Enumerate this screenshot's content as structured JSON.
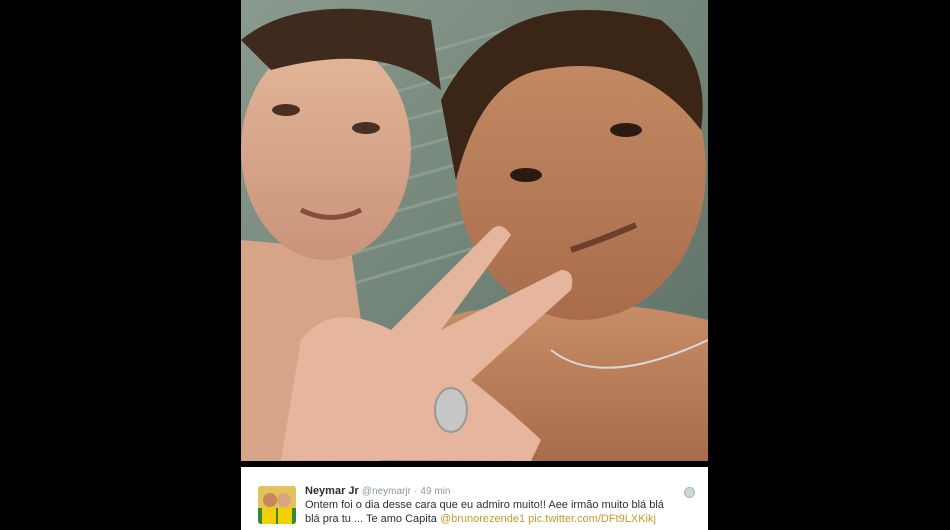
{
  "photo": {
    "icon": "selfie-photo"
  },
  "tweet": {
    "author_name": "Neymar Jr",
    "author_handle": "@neymarjr",
    "separator": "·",
    "time": "49 min",
    "text_part1": "Ontem foi o dia desse cara que eu admiro muito!! Aee irmão muito blá blá blá pra tu ... Te amo Capita",
    "mention": "@brunorezende1",
    "media_link": "pic.twitter.com/DFt9LXKikj",
    "avatar_icon": "avatar-icon",
    "link_color": "#c69a2a"
  }
}
